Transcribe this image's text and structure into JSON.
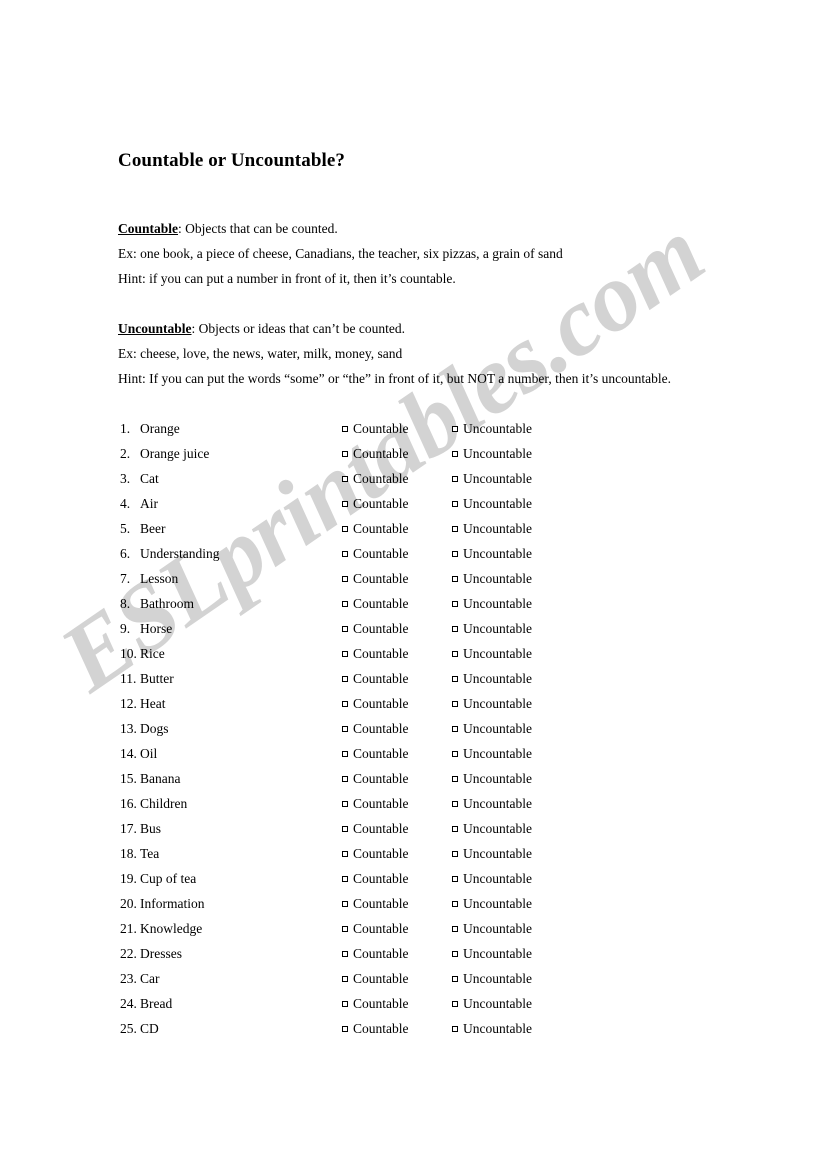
{
  "document": {
    "title": "Countable or Uncountable?"
  },
  "watermark": {
    "text": "ESLprintables.com",
    "color": "#d3d3d3"
  },
  "definitions": {
    "countable": {
      "term": "Countable",
      "definition": ": Objects that can be counted.",
      "example": "Ex: one book, a piece of cheese, Canadians, the teacher, six pizzas, a grain of sand",
      "hint": "Hint: if you can put a number in front of it, then it’s countable."
    },
    "uncountable": {
      "term": "Uncountable",
      "definition": ": Objects or ideas that can’t be counted.",
      "example": "Ex: cheese, love, the news, water, milk, money, sand",
      "hint": "Hint: If you can put the words “some” or “the” in front of it, but NOT a number, then it’s uncountable."
    }
  },
  "options": {
    "countable_label": "Countable",
    "uncountable_label": "Uncountable"
  },
  "exercise": {
    "items": [
      {
        "number": "1.",
        "word": "Orange"
      },
      {
        "number": "2.",
        "word": "Orange juice"
      },
      {
        "number": "3.",
        "word": "Cat"
      },
      {
        "number": "4.",
        "word": "Air"
      },
      {
        "number": "5.",
        "word": "Beer"
      },
      {
        "number": "6.",
        "word": "Understanding"
      },
      {
        "number": "7.",
        "word": "Lesson"
      },
      {
        "number": "8.",
        "word": "Bathroom"
      },
      {
        "number": "9.",
        "word": "Horse"
      },
      {
        "number": "10.",
        "word": "Rice"
      },
      {
        "number": "11.",
        "word": "Butter"
      },
      {
        "number": "12.",
        "word": "Heat"
      },
      {
        "number": "13.",
        "word": "Dogs"
      },
      {
        "number": "14.",
        "word": "Oil"
      },
      {
        "number": "15.",
        "word": "Banana"
      },
      {
        "number": "16.",
        "word": "Children"
      },
      {
        "number": "17.",
        "word": "Bus"
      },
      {
        "number": "18.",
        "word": "Tea"
      },
      {
        "number": "19.",
        "word": "Cup of tea"
      },
      {
        "number": "20.",
        "word": "Information"
      },
      {
        "number": "21.",
        "word": "Knowledge"
      },
      {
        "number": "22.",
        "word": "Dresses"
      },
      {
        "number": "23.",
        "word": "Car"
      },
      {
        "number": "24.",
        "word": "Bread"
      },
      {
        "number": "25.",
        "word": "CD"
      }
    ]
  }
}
